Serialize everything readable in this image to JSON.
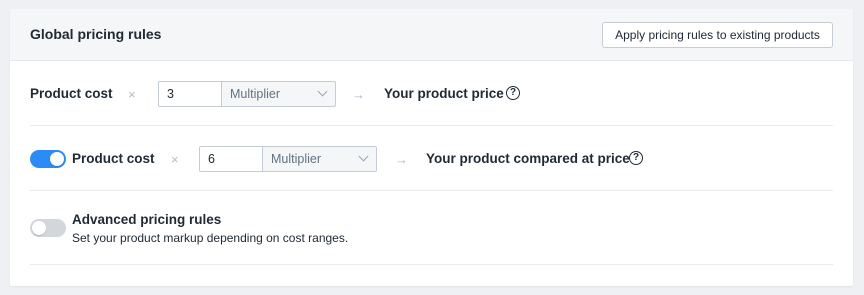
{
  "header": {
    "title": "Global pricing rules",
    "apply_button": "Apply pricing rules to existing products"
  },
  "rule_price": {
    "label": "Product cost",
    "operator": "×",
    "value": "3",
    "mode": "Multiplier",
    "arrow": "→",
    "result": "Your product price",
    "help": "?"
  },
  "rule_compare": {
    "toggle_on": true,
    "label": "Product cost",
    "operator": "×",
    "value": "6",
    "mode": "Multiplier",
    "arrow": "→",
    "result": "Your product compared at price",
    "help": "?"
  },
  "advanced": {
    "toggle_on": false,
    "title": "Advanced pricing rules",
    "description": "Set your product markup depending on cost ranges."
  },
  "colors": {
    "accent": "#2b8cf7",
    "toggle_off": "#d3d6da",
    "header_bg": "#f4f6f8"
  }
}
